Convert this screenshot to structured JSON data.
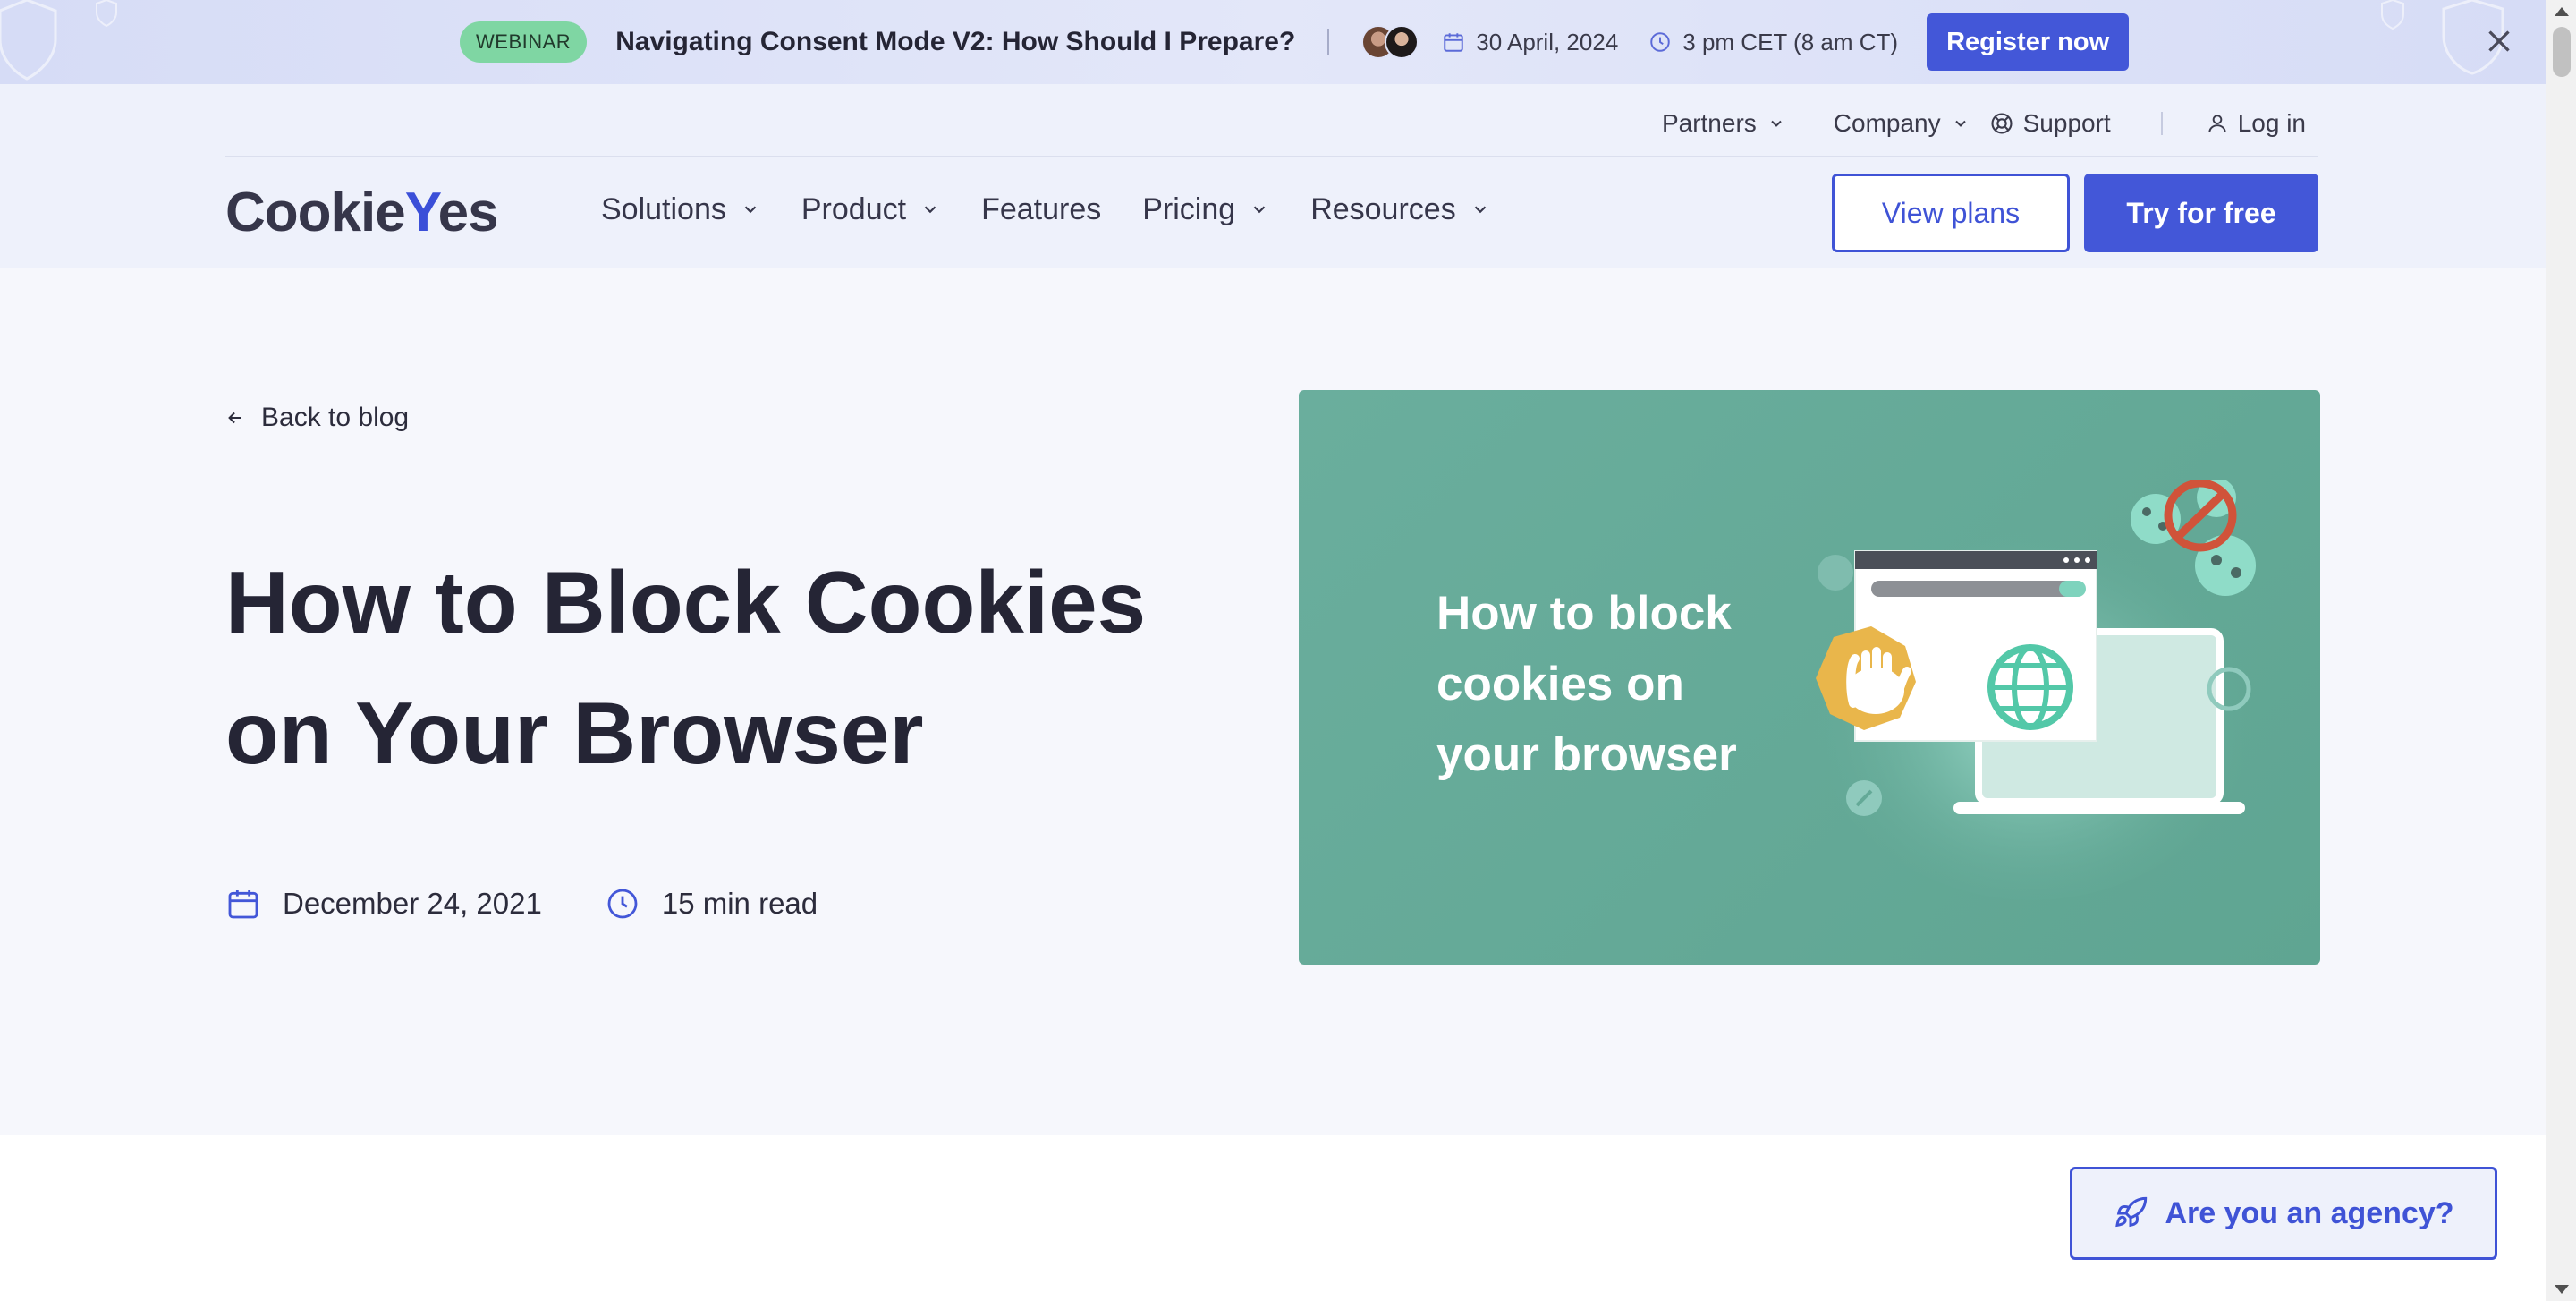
{
  "banner": {
    "badge": "WEBINAR",
    "title": "Navigating Consent Mode V2: How Should I Prepare?",
    "date": "30 April, 2024",
    "time": "3 pm CET (8 am CT)",
    "register_label": "Register now"
  },
  "topnav": {
    "partners": "Partners",
    "company": "Company",
    "support": "Support",
    "login": "Log in"
  },
  "logo": {
    "prefix": "Cookie",
    "accent": "Y",
    "suffix": "es"
  },
  "mainnav": {
    "solutions": "Solutions",
    "product": "Product",
    "features": "Features",
    "pricing": "Pricing",
    "resources": "Resources"
  },
  "actions": {
    "view_plans": "View plans",
    "try_free": "Try for free"
  },
  "hero": {
    "back_label": "Back to blog",
    "title_line1": "How to Block Cookies",
    "title_line2": "on Your Browser",
    "date": "December 24, 2021",
    "read_time": "15 min read",
    "image_text_line1": "How to block",
    "image_text_line2": "cookies on",
    "image_text_line3": "your browser"
  },
  "agency": {
    "label": "Are you an agency?"
  },
  "colors": {
    "brand": "#4357d8",
    "badge": "#7fd6a3",
    "hero_image": "#64a997",
    "text": "#252535"
  }
}
